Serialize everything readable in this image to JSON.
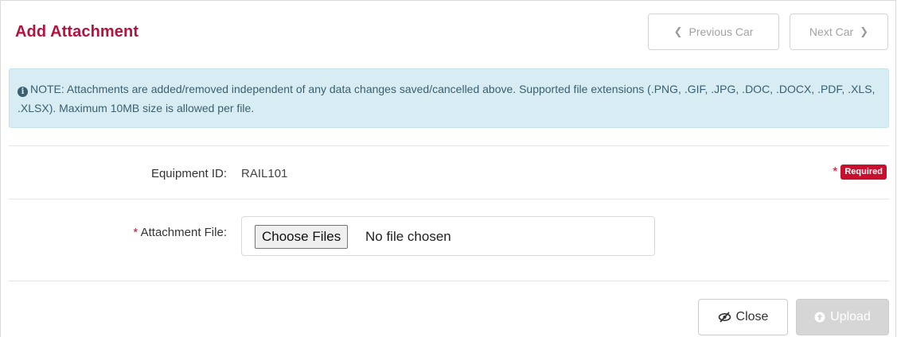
{
  "header": {
    "title": "Add Attachment",
    "prev_label": "Previous Car",
    "next_label": "Next Car",
    "prev_icon": "chevron-left-icon",
    "next_icon": "chevron-right-icon"
  },
  "note": {
    "icon": "info-circle-icon",
    "text": "NOTE: Attachments are added/removed independent of any data changes saved/cancelled above. Supported file extensions (.PNG, .GIF, .JPG, .DOC, .DOCX, .PDF, .XLS, .XLSX). Maximum 10MB size is allowed per file."
  },
  "form": {
    "equipment_label": "Equipment ID:",
    "equipment_value": "RAIL101",
    "required_star": "*",
    "required_label": "Required",
    "file_label_star": "*",
    "file_label": "Attachment File:",
    "choose_button": "Choose Files",
    "file_status": "No file chosen"
  },
  "footer": {
    "close_label": "Close",
    "close_icon": "eye-slash-icon",
    "upload_label": "Upload",
    "upload_icon": "arrow-up-circle-icon",
    "upload_disabled": true
  },
  "colors": {
    "title": "#b5123e",
    "alert_bg": "#d8edf3",
    "required": "#c8102e",
    "disabled_button": "#d6d6d6"
  }
}
